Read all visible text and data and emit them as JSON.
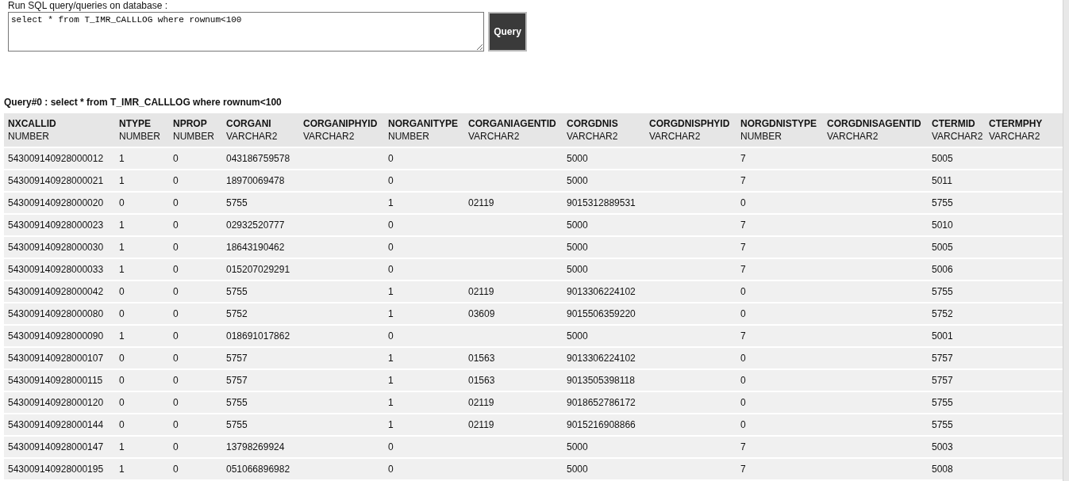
{
  "query_form": {
    "label": "Run SQL query/queries on database :",
    "query_input": {
      "value": "select * from T_IMR_CALLLOG where rownum<100"
    },
    "submit_button": "Query"
  },
  "result": {
    "title": "Query#0 : select * from T_IMR_CALLLOG where rownum<100",
    "table": {
      "columns": [
        {
          "name": "NXCALLID",
          "type": "NUMBER"
        },
        {
          "name": "NTYPE",
          "type": "NUMBER"
        },
        {
          "name": "NPROP",
          "type": "NUMBER"
        },
        {
          "name": "CORGANI",
          "type": "VARCHAR2"
        },
        {
          "name": "CORGANIPHYID",
          "type": "VARCHAR2"
        },
        {
          "name": "NORGANITYPE",
          "type": "NUMBER"
        },
        {
          "name": "CORGANIAGENTID",
          "type": "VARCHAR2"
        },
        {
          "name": "CORGDNIS",
          "type": "VARCHAR2"
        },
        {
          "name": "CORGDNISPHYID",
          "type": "VARCHAR2"
        },
        {
          "name": "NORGDNISTYPE",
          "type": "NUMBER"
        },
        {
          "name": "CORGDNISAGENTID",
          "type": "VARCHAR2"
        },
        {
          "name": "CTERMID",
          "type": "VARCHAR2"
        },
        {
          "name": "CTERMPHY",
          "type": "VARCHAR2"
        }
      ],
      "rows": [
        [
          "543009140928000012",
          "1",
          "0",
          "043186759578",
          null,
          "0",
          null,
          "5000",
          null,
          "7",
          null,
          "5005"
        ],
        [
          "543009140928000021",
          "1",
          "0",
          "18970069478",
          null,
          "0",
          null,
          "5000",
          null,
          "7",
          null,
          "5011"
        ],
        [
          "543009140928000020",
          "0",
          "0",
          "5755",
          null,
          "1",
          "02119",
          "9015312889531",
          null,
          "0",
          null,
          "5755"
        ],
        [
          "543009140928000023",
          "1",
          "0",
          "02932520777",
          null,
          "0",
          null,
          "5000",
          null,
          "7",
          null,
          "5010"
        ],
        [
          "543009140928000030",
          "1",
          "0",
          "18643190462",
          null,
          "0",
          null,
          "5000",
          null,
          "7",
          null,
          "5005"
        ],
        [
          "543009140928000033",
          "1",
          "0",
          "015207029291",
          null,
          "0",
          null,
          "5000",
          null,
          "7",
          null,
          "5006"
        ],
        [
          "543009140928000042",
          "0",
          "0",
          "5755",
          null,
          "1",
          "02119",
          "9013306224102",
          null,
          "0",
          null,
          "5755"
        ],
        [
          "543009140928000080",
          "0",
          "0",
          "5752",
          null,
          "1",
          "03609",
          "9015506359220",
          null,
          "0",
          null,
          "5752"
        ],
        [
          "543009140928000090",
          "1",
          "0",
          "018691017862",
          null,
          "0",
          null,
          "5000",
          null,
          "7",
          null,
          "5001"
        ],
        [
          "543009140928000107",
          "0",
          "0",
          "5757",
          null,
          "1",
          "01563",
          "9013306224102",
          null,
          "0",
          null,
          "5757"
        ],
        [
          "543009140928000115",
          "0",
          "0",
          "5757",
          null,
          "1",
          "01563",
          "9013505398118",
          null,
          "0",
          null,
          "5757"
        ],
        [
          "543009140928000120",
          "0",
          "0",
          "5755",
          null,
          "1",
          "02119",
          "9018652786172",
          null,
          "0",
          null,
          "5755"
        ],
        [
          "543009140928000144",
          "0",
          "0",
          "5755",
          null,
          "1",
          "02119",
          "9015216908866",
          null,
          "0",
          null,
          "5755"
        ],
        [
          "543009140928000147",
          "1",
          "0",
          "13798269924",
          null,
          "0",
          null,
          "5000",
          null,
          "7",
          null,
          "5003"
        ],
        [
          "543009140928000195",
          "1",
          "0",
          "051066896982",
          null,
          "0",
          null,
          "5000",
          null,
          "7",
          null,
          "5008"
        ]
      ]
    }
  }
}
